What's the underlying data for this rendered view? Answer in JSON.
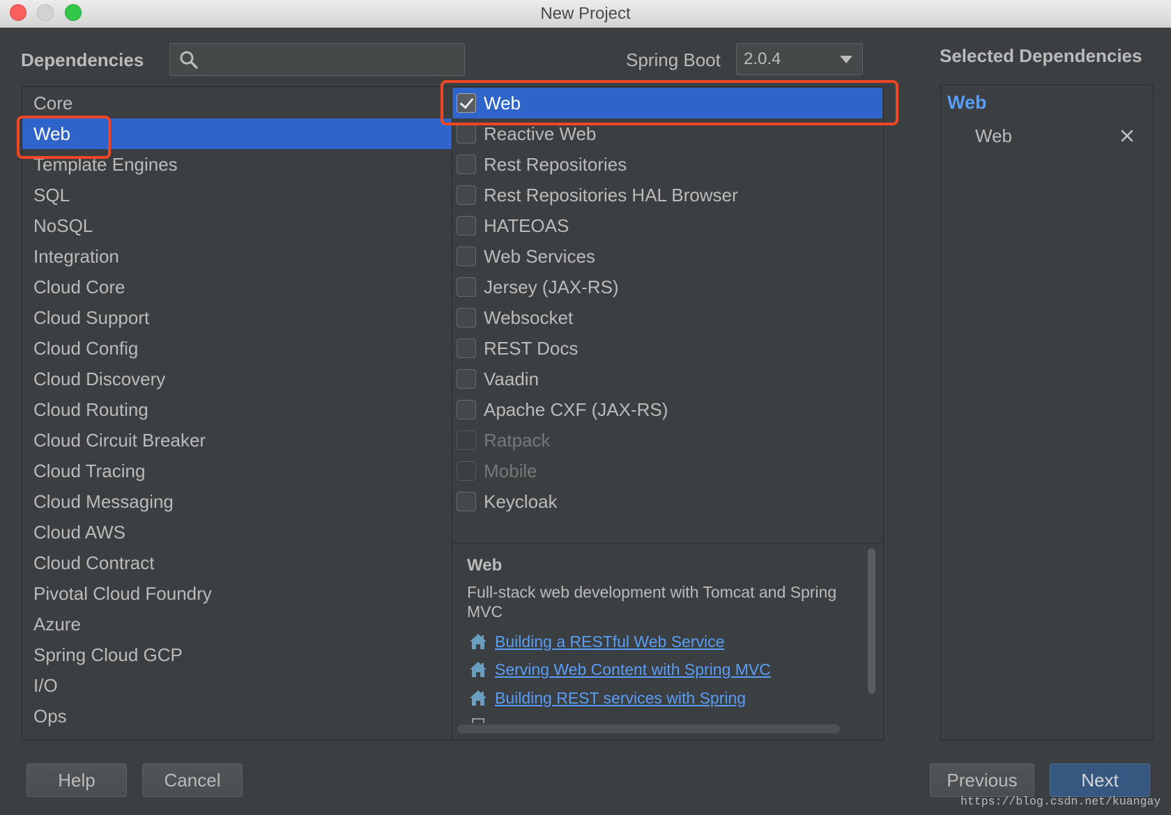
{
  "window": {
    "title": "New Project"
  },
  "colors": {
    "background": "#3c3f41",
    "selection": "#2f65ca",
    "text": "#bbbbbb",
    "link": "#589df6",
    "annotation": "#ef4724",
    "primary_button": "#365880"
  },
  "header": {
    "dependencies_label": "Dependencies",
    "search_icon": "search-icon",
    "search_value": "",
    "spring_boot_label": "Spring Boot",
    "spring_boot_version": "2.0.4"
  },
  "categories": [
    {
      "label": "Core",
      "selected": false
    },
    {
      "label": "Web",
      "selected": true
    },
    {
      "label": "Template Engines",
      "selected": false
    },
    {
      "label": "SQL",
      "selected": false
    },
    {
      "label": "NoSQL",
      "selected": false
    },
    {
      "label": "Integration",
      "selected": false
    },
    {
      "label": "Cloud Core",
      "selected": false
    },
    {
      "label": "Cloud Support",
      "selected": false
    },
    {
      "label": "Cloud Config",
      "selected": false
    },
    {
      "label": "Cloud Discovery",
      "selected": false
    },
    {
      "label": "Cloud Routing",
      "selected": false
    },
    {
      "label": "Cloud Circuit Breaker",
      "selected": false
    },
    {
      "label": "Cloud Tracing",
      "selected": false
    },
    {
      "label": "Cloud Messaging",
      "selected": false
    },
    {
      "label": "Cloud AWS",
      "selected": false
    },
    {
      "label": "Cloud Contract",
      "selected": false
    },
    {
      "label": "Pivotal Cloud Foundry",
      "selected": false
    },
    {
      "label": "Azure",
      "selected": false
    },
    {
      "label": "Spring Cloud GCP",
      "selected": false
    },
    {
      "label": "I/O",
      "selected": false
    },
    {
      "label": "Ops",
      "selected": false
    }
  ],
  "dependencies": [
    {
      "label": "Web",
      "checked": true,
      "selected": true,
      "disabled": false
    },
    {
      "label": "Reactive Web",
      "checked": false,
      "selected": false,
      "disabled": false
    },
    {
      "label": "Rest Repositories",
      "checked": false,
      "selected": false,
      "disabled": false
    },
    {
      "label": "Rest Repositories HAL Browser",
      "checked": false,
      "selected": false,
      "disabled": false
    },
    {
      "label": "HATEOAS",
      "checked": false,
      "selected": false,
      "disabled": false
    },
    {
      "label": "Web Services",
      "checked": false,
      "selected": false,
      "disabled": false
    },
    {
      "label": "Jersey (JAX-RS)",
      "checked": false,
      "selected": false,
      "disabled": false
    },
    {
      "label": "Websocket",
      "checked": false,
      "selected": false,
      "disabled": false
    },
    {
      "label": "REST Docs",
      "checked": false,
      "selected": false,
      "disabled": false
    },
    {
      "label": "Vaadin",
      "checked": false,
      "selected": false,
      "disabled": false
    },
    {
      "label": "Apache CXF (JAX-RS)",
      "checked": false,
      "selected": false,
      "disabled": false
    },
    {
      "label": "Ratpack",
      "checked": false,
      "selected": false,
      "disabled": true
    },
    {
      "label": "Mobile",
      "checked": false,
      "selected": false,
      "disabled": true
    },
    {
      "label": "Keycloak",
      "checked": false,
      "selected": false,
      "disabled": false
    }
  ],
  "description": {
    "title": "Web",
    "text": "Full-stack web development with Tomcat and Spring MVC",
    "links": [
      {
        "label": "Building a RESTful Web Service",
        "icon": "house-icon"
      },
      {
        "label": "Serving Web Content with Spring MVC",
        "icon": "house-icon"
      },
      {
        "label": "Building REST services with Spring",
        "icon": "house-icon"
      }
    ]
  },
  "selected_dependencies": {
    "title": "Selected Dependencies",
    "groups": [
      {
        "name": "Web",
        "items": [
          {
            "label": "Web",
            "remove_icon": "close-icon"
          }
        ]
      }
    ]
  },
  "buttons": {
    "help": "Help",
    "cancel": "Cancel",
    "previous": "Previous",
    "next": "Next"
  },
  "watermark": "https://blog.csdn.net/kuangay"
}
